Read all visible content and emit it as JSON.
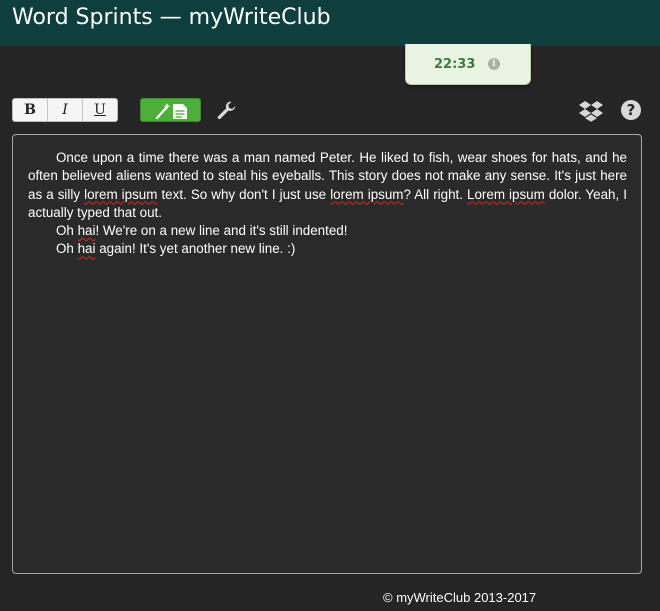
{
  "app": {
    "title": "Word Sprints — myWriteClub"
  },
  "timer": {
    "time": "22:33",
    "info_icon": "info-icon"
  },
  "toolbar": {
    "bold_label": "B",
    "italic_label": "I",
    "underline_label": "U",
    "green_button_icon": "wand-document-icon",
    "settings_icon": "wrench-icon",
    "dropbox_icon": "dropbox-icon",
    "help_label": "?"
  },
  "editor": {
    "para1": [
      "Once upon a time there was a man named Peter. He liked to fish, wear shoes for hats, and he often believed aliens wanted to steal his eyeballs. This story does not make any sense. It's just here as a silly ",
      "lorem ipsum",
      " text. So why don't I just use ",
      "lorem ipsum",
      "? All right. ",
      "Lorem ipsum",
      " dolor. Yeah, I actually typed that out."
    ],
    "para2": [
      "Oh ",
      "hai",
      "! We're on a new line and it's still indented!"
    ],
    "para3": [
      "Oh ",
      "hai",
      " again! It's yet another new line. :)"
    ]
  },
  "colors": {
    "header_bg": "#0f3e3f",
    "accent_green": "#4caf3a",
    "timer_text": "#3e7b3b",
    "spell_error": "#d9261c"
  },
  "footer": {
    "text": "© myWriteClub 2013-2017"
  }
}
